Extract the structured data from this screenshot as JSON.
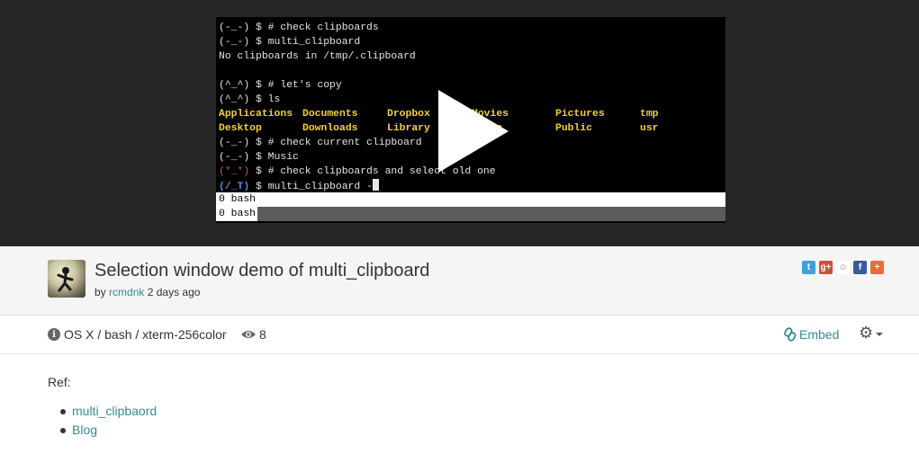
{
  "terminal": {
    "lines": [
      "(-_-) $ # check clipboards",
      "(-_-) $ multi_clipboard",
      "No clipboards in /tmp/.clipboard",
      "",
      "(^_^) $ # let's copy",
      "(^_^) $ ls"
    ],
    "ls_row1": [
      "Applications",
      "Documents",
      "Dropbox",
      "Movies",
      "Pictures",
      "tmp"
    ],
    "ls_row2": [
      "Desktop",
      "Downloads",
      "Library",
      "Music",
      "Public",
      "usr"
    ],
    "line_check_current": "(-_-) $ # check current clipboard",
    "line_music": "(-_-) $ Music",
    "line_select_prompt": "(*_*)",
    "line_select_cmd": " $ # check clipboards and select old one",
    "line_final_prompt": "(/_T)",
    "line_final_cmd": " $ multi_clipboard -",
    "tmux_bar_1": "0 bash",
    "tmux_bar_2": "0 bash"
  },
  "video": {
    "play_icon": "play-icon"
  },
  "recording": {
    "title": "Selection window demo of multi_clipboard",
    "by": "by",
    "author": "rcmdnk",
    "time": "2 days ago"
  },
  "share": {
    "twitter": "t",
    "google": "g+",
    "reddit": "☺",
    "facebook": "f",
    "more": "+"
  },
  "meta": {
    "env": "OS X / bash / xterm-256color",
    "views": "8",
    "embed": "Embed"
  },
  "description": {
    "ref": "Ref:",
    "links": [
      "multi_clipbaord",
      "Blog"
    ]
  },
  "colors": {
    "link": "#3a8a8c",
    "stage": "#262626",
    "titlebar": "#f5f5f5"
  }
}
